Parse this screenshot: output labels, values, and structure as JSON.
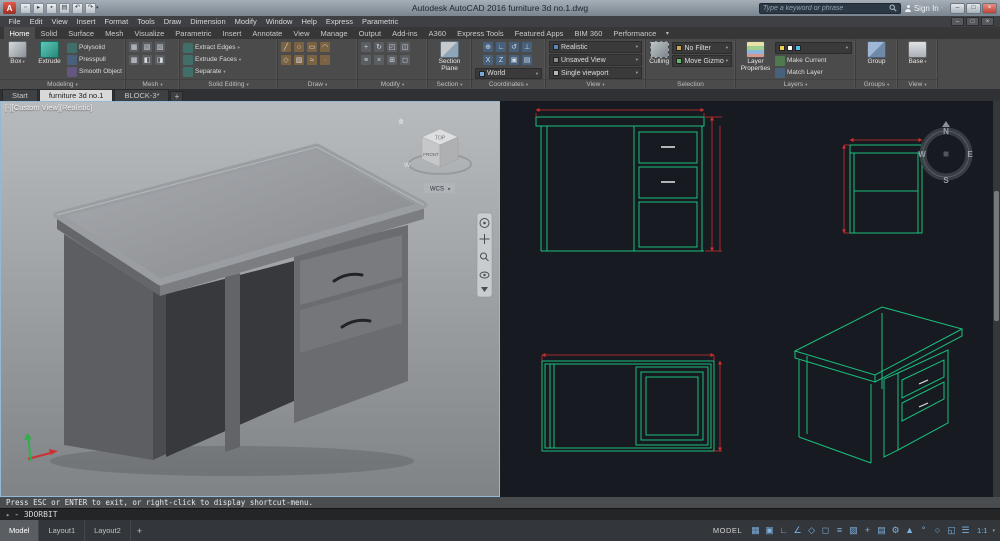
{
  "glyphs": {
    "caret": "▾",
    "min": "–",
    "max": "□",
    "close": "×",
    "plus": "+",
    "prompt": "▸"
  },
  "titlebar": {
    "app_title": "Autodesk AutoCAD 2016   furniture 3d no.1.dwg",
    "search_placeholder": "Type a keyword or phrase",
    "signin_label": "Sign In",
    "logo_letter": "A",
    "quick_access": [
      {
        "name": "qat-new-icon",
        "glyph": "▫"
      },
      {
        "name": "qat-open-icon",
        "glyph": "▸"
      },
      {
        "name": "qat-save-icon",
        "glyph": "▪"
      },
      {
        "name": "qat-print-icon",
        "glyph": "▤"
      },
      {
        "name": "qat-undo-icon",
        "glyph": "↶"
      },
      {
        "name": "qat-redo-icon",
        "glyph": "↷"
      }
    ]
  },
  "menubar": {
    "items": [
      "File",
      "Edit",
      "View",
      "Insert",
      "Format",
      "Tools",
      "Draw",
      "Dimension",
      "Modify",
      "Window",
      "Help",
      "Express",
      "Parametric"
    ]
  },
  "ribbon_tabs": {
    "items": [
      {
        "name": "tab-home",
        "label": "Home",
        "active": true
      },
      {
        "name": "tab-solid",
        "label": "Solid"
      },
      {
        "name": "tab-surface",
        "label": "Surface"
      },
      {
        "name": "tab-mesh",
        "label": "Mesh"
      },
      {
        "name": "tab-visualize",
        "label": "Visualize"
      },
      {
        "name": "tab-parametric",
        "label": "Parametric"
      },
      {
        "name": "tab-insert",
        "label": "Insert"
      },
      {
        "name": "tab-annotate",
        "label": "Annotate"
      },
      {
        "name": "tab-view",
        "label": "View"
      },
      {
        "name": "tab-manage",
        "label": "Manage"
      },
      {
        "name": "tab-output",
        "label": "Output"
      },
      {
        "name": "tab-addins",
        "label": "Add-ins"
      },
      {
        "name": "tab-a360",
        "label": "A360"
      },
      {
        "name": "tab-express-tools",
        "label": "Express Tools"
      },
      {
        "name": "tab-featured-apps",
        "label": "Featured Apps"
      },
      {
        "name": "tab-bim360",
        "label": "BIM 360"
      },
      {
        "name": "tab-performance",
        "label": "Performance"
      }
    ]
  },
  "ribbon": {
    "modeling": {
      "label": "Modeling",
      "box_label": "Box",
      "extrude_label": "Extrude",
      "polysolid_label": "Polysolid",
      "presspull_label": "Presspull",
      "smooth_label": "Smooth Object"
    },
    "mesh": {
      "label": "Mesh",
      "icons": [
        {
          "name": "mesh-smooth-icon",
          "glyph": "▦"
        },
        {
          "name": "mesh-box-icon",
          "glyph": "▧"
        },
        {
          "name": "mesh-refine-icon",
          "glyph": "▨"
        },
        {
          "name": "mesh-crease-icon",
          "glyph": "▩"
        },
        {
          "name": "mesh-split-icon",
          "glyph": "◧"
        },
        {
          "name": "mesh-extrude-icon",
          "glyph": "◨"
        }
      ]
    },
    "solid_editing": {
      "label": "Solid Editing",
      "rows": [
        {
          "name": "extract-edges-button",
          "label": "Extract Edges"
        },
        {
          "name": "extrude-faces-button",
          "label": "Extrude Faces"
        },
        {
          "name": "separate-button",
          "label": "Separate"
        }
      ]
    },
    "draw": {
      "label": "Draw",
      "icons": [
        {
          "name": "line-icon",
          "glyph": "╱"
        },
        {
          "name": "circle-icon",
          "glyph": "○"
        },
        {
          "name": "rectangle-icon",
          "glyph": "▭"
        },
        {
          "name": "arc-icon",
          "glyph": "◠"
        },
        {
          "name": "polygon-icon",
          "glyph": "◇"
        },
        {
          "name": "hatch-icon",
          "glyph": "▨"
        },
        {
          "name": "spline-icon",
          "glyph": "≈"
        },
        {
          "name": "point-icon",
          "glyph": "·"
        }
      ]
    },
    "modify": {
      "label": "Modify",
      "icons": [
        {
          "name": "move-icon",
          "glyph": "+"
        },
        {
          "name": "rotate-icon",
          "glyph": "↻"
        },
        {
          "name": "scale-icon",
          "glyph": "◰"
        },
        {
          "name": "mirror-icon",
          "glyph": "◫"
        },
        {
          "name": "offset-icon",
          "glyph": "≡"
        },
        {
          "name": "trim-icon",
          "glyph": "×"
        },
        {
          "name": "array-icon",
          "glyph": "⊞"
        },
        {
          "name": "erase-icon",
          "glyph": "◻"
        }
      ]
    },
    "section": {
      "label": "Section",
      "plane_label": "Section Plane"
    },
    "coordinates": {
      "label": "Coordinates",
      "ucs_value": "World",
      "icons": [
        {
          "name": "ucs-world-icon",
          "glyph": "⊕"
        },
        {
          "name": "ucs-icon",
          "glyph": "∟"
        },
        {
          "name": "ucs-previous-icon",
          "glyph": "↺"
        },
        {
          "name": "ucs-origin-icon",
          "glyph": "⊥"
        },
        {
          "name": "ucs-x-icon",
          "glyph": "X"
        },
        {
          "name": "ucs-z-icon",
          "glyph": "Z"
        },
        {
          "name": "ucs-view-icon",
          "glyph": "▣"
        },
        {
          "name": "ucs-named-icon",
          "glyph": "▤"
        }
      ]
    },
    "view_panel": {
      "label": "View",
      "visual_style": "Realistic",
      "named_view": "Unsaved View",
      "viewport_conf": "Single viewport"
    },
    "selection": {
      "label": "Selection",
      "culling_label": "Culling",
      "filter_value": "No Filter",
      "gizmo_value": "Move Gizmo"
    },
    "layers": {
      "label": "Layers",
      "properties_label": "Layer Properties",
      "make_current": "Make Current",
      "match_layer": "Match Layer"
    },
    "groups": {
      "label": "Groups",
      "group_label": "Group"
    },
    "view_base": {
      "label": "View",
      "base_label": "Base"
    }
  },
  "file_tabs": {
    "items": [
      {
        "name": "file-tab-start",
        "label": "Start"
      },
      {
        "name": "file-tab-furniture",
        "label": "furniture 3d no.1",
        "active": true
      },
      {
        "name": "file-tab-block3",
        "label": "BLOCK-3*"
      }
    ]
  },
  "viewport_left": {
    "corner_label": "[-][Custom View][Realistic]",
    "viewcube": {
      "top": "TOP",
      "front": "FRONT",
      "west": "W",
      "wcs": "WCS"
    }
  },
  "viewport_right": {
    "compass": {
      "n": "N",
      "e": "E",
      "s": "S",
      "w": "W"
    }
  },
  "command": {
    "message": "Press ESC or ENTER to exit, or right-click to display shortcut-menu.",
    "prompt": "-  3DORBIT"
  },
  "layout_tabs": {
    "items": [
      {
        "name": "layout-tab-model",
        "label": "Model",
        "active": true
      },
      {
        "name": "layout-tab-layout1",
        "label": "Layout1"
      },
      {
        "name": "layout-tab-layout2",
        "label": "Layout2"
      }
    ]
  },
  "statusbar": {
    "model_label": "MODEL",
    "scale_label": "1:1",
    "icons": [
      {
        "name": "grid-icon",
        "glyph": "▦"
      },
      {
        "name": "snap-icon",
        "glyph": "▣"
      },
      {
        "name": "ortho-icon",
        "glyph": "∟"
      },
      {
        "name": "polar-icon",
        "glyph": "∠"
      },
      {
        "name": "isodraft-icon",
        "glyph": "◇"
      },
      {
        "name": "osnap-icon",
        "glyph": "◻"
      },
      {
        "name": "lineweight-icon",
        "glyph": "≡"
      },
      {
        "name": "transparency-icon",
        "glyph": "▧"
      },
      {
        "name": "dynamic-input-icon",
        "glyph": "+"
      },
      {
        "name": "selection-cycling-icon",
        "glyph": "▤"
      },
      {
        "name": "workspace-gear-icon",
        "glyph": "⚙"
      },
      {
        "name": "annotation-icon",
        "glyph": "▲"
      },
      {
        "name": "units-icon",
        "glyph": "°"
      },
      {
        "name": "isolate-icon",
        "glyph": "○"
      },
      {
        "name": "clean-screen-icon",
        "glyph": "◱"
      },
      {
        "name": "customization-icon",
        "glyph": "☰"
      }
    ]
  }
}
